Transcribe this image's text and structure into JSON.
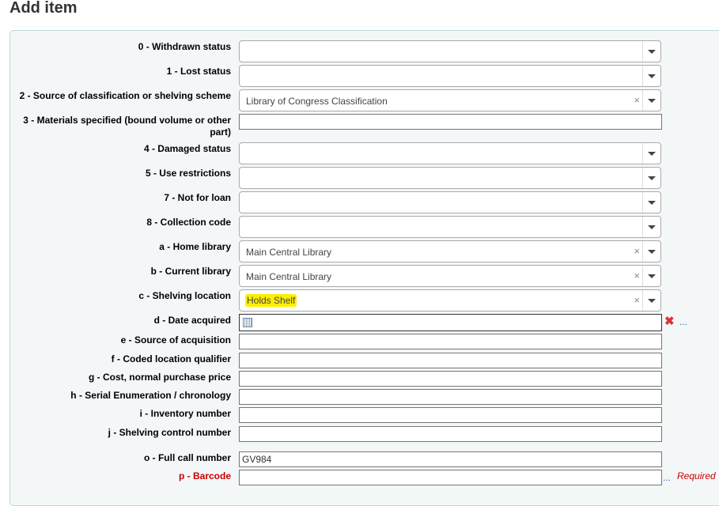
{
  "title": "Add item",
  "fields": [
    {
      "label": "0 - Withdrawn status",
      "type": "select",
      "value": ""
    },
    {
      "label": "1 - Lost status",
      "type": "select",
      "value": ""
    },
    {
      "label": "2 - Source of classification or shelving scheme",
      "type": "select",
      "value": "Library of Congress Classification"
    },
    {
      "label": "3 - Materials specified (bound volume or other part)",
      "type": "text",
      "value": ""
    },
    {
      "label": "4 - Damaged status",
      "type": "select",
      "value": ""
    },
    {
      "label": "5 - Use restrictions",
      "type": "select",
      "value": ""
    },
    {
      "label": "7 - Not for loan",
      "type": "select",
      "value": ""
    },
    {
      "label": "8 - Collection code",
      "type": "select",
      "value": ""
    },
    {
      "label": "a - Home library",
      "type": "select",
      "value": "Main Central Library"
    },
    {
      "label": "b - Current library",
      "type": "select",
      "value": "Main Central Library"
    },
    {
      "label": "c - Shelving location",
      "type": "select",
      "value": "Holds Shelf"
    },
    {
      "label": "d - Date acquired",
      "type": "date",
      "value": ""
    },
    {
      "label": "e - Source of acquisition",
      "type": "text",
      "value": ""
    },
    {
      "label": "f - Coded location qualifier",
      "type": "text",
      "value": ""
    },
    {
      "label": "g - Cost, normal purchase price",
      "type": "text",
      "value": ""
    },
    {
      "label": "h - Serial Enumeration / chronology",
      "type": "text",
      "value": ""
    },
    {
      "label": "i - Inventory number",
      "type": "text",
      "value": ""
    },
    {
      "label": "j - Shelving control number",
      "type": "text",
      "value": ""
    },
    {
      "label": "o - Full call number",
      "type": "text",
      "value": "GV984"
    },
    {
      "label": "p - Barcode",
      "type": "text",
      "value": "",
      "required_text": "Required"
    }
  ],
  "ellipsis": "...",
  "clear_symbol": "×"
}
